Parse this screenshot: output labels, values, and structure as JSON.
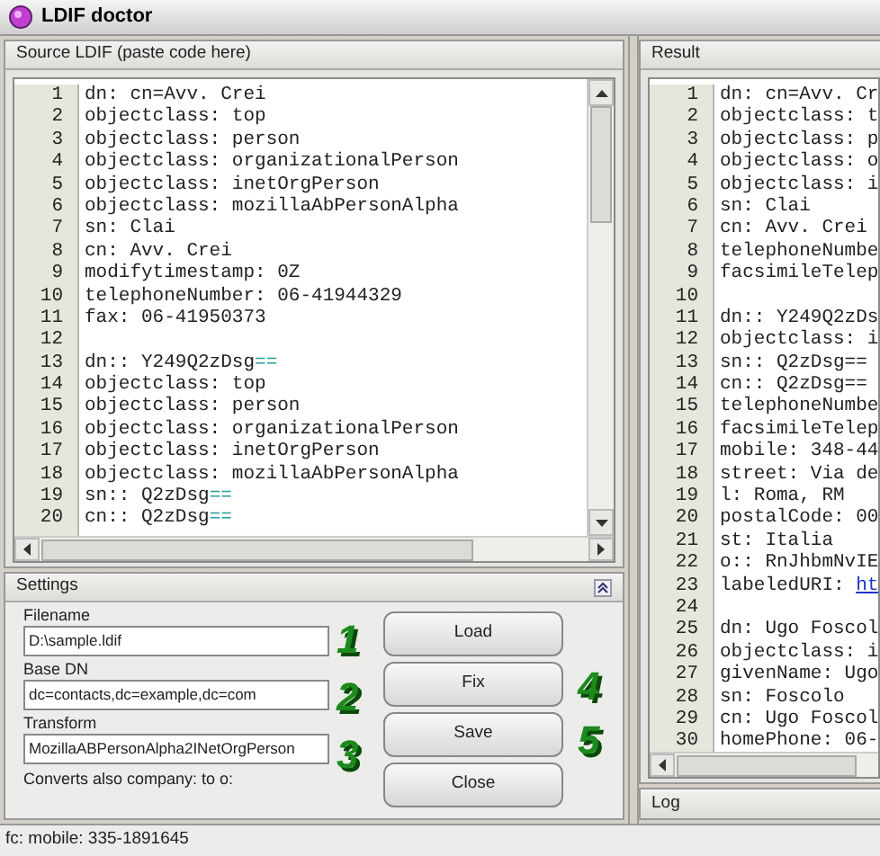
{
  "window": {
    "title": "LDIF doctor"
  },
  "source": {
    "title": "Source LDIF (paste code here)",
    "lines": [
      {
        "number": "1",
        "parts": [
          {
            "kind": "plain",
            "text": "dn: cn=Avv. Crei"
          }
        ]
      },
      {
        "number": "2",
        "parts": [
          {
            "kind": "plain",
            "text": "objectclass: top"
          }
        ]
      },
      {
        "number": "3",
        "parts": [
          {
            "kind": "plain",
            "text": "objectclass: person"
          }
        ]
      },
      {
        "number": "4",
        "parts": [
          {
            "kind": "plain",
            "text": "objectclass: organizationalPerson"
          }
        ]
      },
      {
        "number": "5",
        "parts": [
          {
            "kind": "plain",
            "text": "objectclass: inetOrgPerson"
          }
        ]
      },
      {
        "number": "6",
        "parts": [
          {
            "kind": "plain",
            "text": "objectclass: mozillaAbPersonAlpha"
          }
        ]
      },
      {
        "number": "7",
        "parts": [
          {
            "kind": "plain",
            "text": "sn: Clai"
          }
        ]
      },
      {
        "number": "8",
        "parts": [
          {
            "kind": "plain",
            "text": "cn: Avv. Crei"
          }
        ]
      },
      {
        "number": "9",
        "parts": [
          {
            "kind": "plain",
            "text": "modifytimestamp: 0Z"
          }
        ]
      },
      {
        "number": "10",
        "parts": [
          {
            "kind": "plain",
            "text": "telephoneNumber: 06-41944329"
          }
        ]
      },
      {
        "number": "11",
        "parts": [
          {
            "kind": "plain",
            "text": "fax: 06-41950373"
          }
        ]
      },
      {
        "number": "12"
      },
      {
        "number": "13",
        "parts": [
          {
            "kind": "plain",
            "text": "dn:: Y249Q2zDsg"
          },
          {
            "kind": "padding",
            "text": "=="
          }
        ]
      },
      {
        "number": "14",
        "parts": [
          {
            "kind": "plain",
            "text": "objectclass: top"
          }
        ]
      },
      {
        "number": "15",
        "parts": [
          {
            "kind": "plain",
            "text": "objectclass: person"
          }
        ]
      },
      {
        "number": "16",
        "parts": [
          {
            "kind": "plain",
            "text": "objectclass: organizationalPerson"
          }
        ]
      },
      {
        "number": "17",
        "parts": [
          {
            "kind": "plain",
            "text": "objectclass: inetOrgPerson"
          }
        ]
      },
      {
        "number": "18",
        "parts": [
          {
            "kind": "plain",
            "text": "objectclass: mozillaAbPersonAlpha"
          }
        ]
      },
      {
        "number": "19",
        "parts": [
          {
            "kind": "plain",
            "text": "sn:: Q2zDsg"
          },
          {
            "kind": "padding",
            "text": "=="
          }
        ]
      },
      {
        "number": "20",
        "parts": [
          {
            "kind": "plain",
            "text": "cn:: Q2zDsg"
          },
          {
            "kind": "padding",
            "text": "=="
          }
        ]
      }
    ]
  },
  "settings": {
    "title": "Settings",
    "expanded": true,
    "fields": [
      {
        "label": "Filename",
        "value": "D:\\sample.ldif"
      },
      {
        "label": "Base DN",
        "value": "dc=contacts,dc=example,dc=com"
      },
      {
        "label": "Transform",
        "value": "MozillaABPersonAlpha2INetOrgPerson"
      }
    ],
    "note": "Converts also company: to o:",
    "buttons": [
      "Load",
      "Fix",
      "Save",
      "Close"
    ],
    "callouts": [
      "1",
      "2",
      "3",
      "4",
      "5"
    ]
  },
  "result": {
    "title": "Result",
    "lines": [
      {
        "number": "1",
        "parts": [
          {
            "kind": "plain",
            "text": "dn: cn=Avv. Cr"
          }
        ]
      },
      {
        "number": "2",
        "parts": [
          {
            "kind": "plain",
            "text": "objectclass: t"
          }
        ]
      },
      {
        "number": "3",
        "parts": [
          {
            "kind": "plain",
            "text": "objectclass: p"
          }
        ]
      },
      {
        "number": "4",
        "parts": [
          {
            "kind": "plain",
            "text": "objectclass: o"
          }
        ]
      },
      {
        "number": "5",
        "parts": [
          {
            "kind": "plain",
            "text": "objectclass: i"
          }
        ]
      },
      {
        "number": "6",
        "parts": [
          {
            "kind": "plain",
            "text": "sn: Clai"
          }
        ]
      },
      {
        "number": "7",
        "parts": [
          {
            "kind": "plain",
            "text": "cn: Avv. Crei"
          }
        ]
      },
      {
        "number": "8",
        "parts": [
          {
            "kind": "plain",
            "text": "telephoneNumbe"
          }
        ]
      },
      {
        "number": "9",
        "parts": [
          {
            "kind": "plain",
            "text": "facsimileTelep"
          }
        ]
      },
      {
        "number": "10"
      },
      {
        "number": "11",
        "parts": [
          {
            "kind": "plain",
            "text": "dn:: Y249Q2zDs"
          }
        ]
      },
      {
        "number": "12",
        "parts": [
          {
            "kind": "plain",
            "text": "objectclass: i"
          }
        ]
      },
      {
        "number": "13",
        "parts": [
          {
            "kind": "plain",
            "text": "sn:: Q2zDsg=="
          }
        ]
      },
      {
        "number": "14",
        "parts": [
          {
            "kind": "plain",
            "text": "cn:: Q2zDsg=="
          }
        ]
      },
      {
        "number": "15",
        "parts": [
          {
            "kind": "plain",
            "text": "telephoneNumbe"
          }
        ]
      },
      {
        "number": "16",
        "parts": [
          {
            "kind": "plain",
            "text": "facsimileTelep"
          }
        ]
      },
      {
        "number": "17",
        "parts": [
          {
            "kind": "plain",
            "text": "mobile: 348-44"
          }
        ]
      },
      {
        "number": "18",
        "parts": [
          {
            "kind": "plain",
            "text": "street: Via de"
          }
        ]
      },
      {
        "number": "19",
        "parts": [
          {
            "kind": "plain",
            "text": "l: Roma, RM"
          }
        ]
      },
      {
        "number": "20",
        "parts": [
          {
            "kind": "plain",
            "text": "postalCode: 00"
          }
        ]
      },
      {
        "number": "21",
        "parts": [
          {
            "kind": "plain",
            "text": "st: Italia"
          }
        ]
      },
      {
        "number": "22",
        "parts": [
          {
            "kind": "plain",
            "text": "o:: RnJhbmNvIE"
          }
        ]
      },
      {
        "number": "23",
        "parts": [
          {
            "kind": "plain",
            "text": "labeledURI: "
          },
          {
            "kind": "link",
            "text": "ht"
          }
        ]
      },
      {
        "number": "24"
      },
      {
        "number": "25",
        "parts": [
          {
            "kind": "plain",
            "text": "dn: Ugo Foscol"
          }
        ]
      },
      {
        "number": "26",
        "parts": [
          {
            "kind": "plain",
            "text": "objectclass: i"
          }
        ]
      },
      {
        "number": "27",
        "parts": [
          {
            "kind": "plain",
            "text": "givenName: Ugo"
          }
        ]
      },
      {
        "number": "28",
        "parts": [
          {
            "kind": "plain",
            "text": "sn: Foscolo"
          }
        ]
      },
      {
        "number": "29",
        "parts": [
          {
            "kind": "plain",
            "text": "cn: Ugo Foscol"
          }
        ]
      },
      {
        "number": "30",
        "parts": [
          {
            "kind": "plain",
            "text": "homePhone: 06-"
          }
        ]
      }
    ]
  },
  "log": {
    "title": "Log"
  },
  "status_bar": "fc: mobile: 335-1891645"
}
